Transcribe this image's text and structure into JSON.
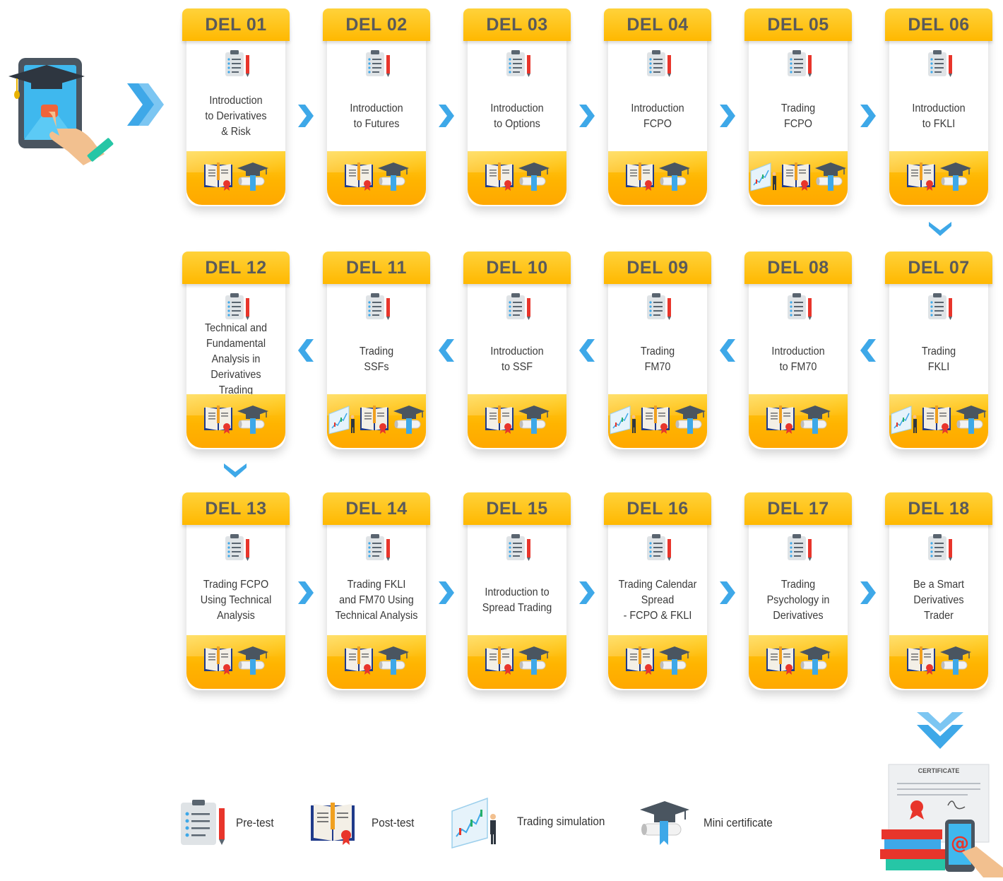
{
  "modules": [
    {
      "code": "DEL 01",
      "title": "Introduction\nto Derivatives\n& Risk",
      "icons": [
        "post-test",
        "mini-certificate"
      ]
    },
    {
      "code": "DEL 02",
      "title": "Introduction\nto Futures",
      "icons": [
        "post-test",
        "mini-certificate"
      ]
    },
    {
      "code": "DEL 03",
      "title": "Introduction\nto Options",
      "icons": [
        "post-test",
        "mini-certificate"
      ]
    },
    {
      "code": "DEL 04",
      "title": "Introduction\nFCPO",
      "icons": [
        "post-test",
        "mini-certificate"
      ]
    },
    {
      "code": "DEL 05",
      "title": "Trading\nFCPO",
      "icons": [
        "trading-simulation",
        "post-test",
        "mini-certificate"
      ]
    },
    {
      "code": "DEL 06",
      "title": "Introduction\nto FKLI",
      "icons": [
        "post-test",
        "mini-certificate"
      ]
    },
    {
      "code": "DEL 07",
      "title": "Trading\nFKLI",
      "icons": [
        "trading-simulation",
        "post-test",
        "mini-certificate"
      ]
    },
    {
      "code": "DEL 08",
      "title": "Introduction\nto FM70",
      "icons": [
        "post-test",
        "mini-certificate"
      ]
    },
    {
      "code": "DEL 09",
      "title": "Trading\nFM70",
      "icons": [
        "trading-simulation",
        "post-test",
        "mini-certificate"
      ]
    },
    {
      "code": "DEL 10",
      "title": "Introduction\nto SSF",
      "icons": [
        "post-test",
        "mini-certificate"
      ]
    },
    {
      "code": "DEL 11",
      "title": "Trading\nSSFs",
      "icons": [
        "trading-simulation",
        "post-test",
        "mini-certificate"
      ]
    },
    {
      "code": "DEL 12",
      "title": "Technical and\nFundamental\nAnalysis in\nDerivatives Trading",
      "icons": [
        "post-test",
        "mini-certificate"
      ]
    },
    {
      "code": "DEL 13",
      "title": "Trading FCPO\nUsing Technical\nAnalysis",
      "icons": [
        "post-test",
        "mini-certificate"
      ]
    },
    {
      "code": "DEL 14",
      "title": "Trading FKLI\nand FM70 Using\nTechnical Analysis",
      "icons": [
        "post-test",
        "mini-certificate"
      ]
    },
    {
      "code": "DEL 15",
      "title": "Introduction to\nSpread Trading",
      "icons": [
        "post-test",
        "mini-certificate"
      ]
    },
    {
      "code": "DEL 16",
      "title": "Trading Calendar\nSpread\n- FCPO & FKLI",
      "icons": [
        "post-test",
        "mini-certificate"
      ]
    },
    {
      "code": "DEL 17",
      "title": "Trading\nPsychology in\nDerivatives",
      "icons": [
        "post-test",
        "mini-certificate"
      ]
    },
    {
      "code": "DEL 18",
      "title": "Be a Smart\nDerivatives\nTrader",
      "icons": [
        "post-test",
        "mini-certificate"
      ]
    }
  ],
  "legend": [
    {
      "icon": "pre-test",
      "label": "Pre-test"
    },
    {
      "icon": "post-test",
      "label": "Post-test"
    },
    {
      "icon": "trading-simulation",
      "label": "Trading simulation"
    },
    {
      "icon": "mini-certificate",
      "label": "Mini certificate"
    }
  ],
  "certificate": {
    "label": "CERTIFICATE"
  },
  "colors": {
    "tab": "#ffc400",
    "bottom": "#ffb400",
    "arrow": "#3ea8e8",
    "title_text": "#3a3a3a",
    "tab_text": "#5a5a5a"
  }
}
